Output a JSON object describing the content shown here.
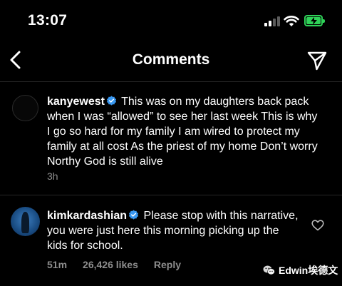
{
  "status_bar": {
    "time": "13:07",
    "battery_color": "#2fd158"
  },
  "header": {
    "title": "Comments",
    "back_icon": "chevron-left-icon",
    "share_icon": "paper-plane-icon"
  },
  "comments": [
    {
      "username": "kanyewest",
      "verified": true,
      "text": "This was on my daughters back pack when I was “allowed” to see her last week This is why I go so hard for my family  I am wired to protect my family at all cost  As the priest of my home  Don’t worry Northy  God is still alive",
      "time": "3h"
    },
    {
      "username": "kimkardashian",
      "verified": true,
      "text": "Please stop with this narrative, you were just here this morning picking up the kids for school.",
      "time": "51m",
      "likes": "26,426 likes",
      "reply_label": "Reply"
    }
  ],
  "watermark": {
    "text": "Edwin埃德文"
  },
  "colors": {
    "background": "#000000",
    "secondary_text": "#8e8e8e",
    "verified_badge": "#3897f0",
    "divider": "#262626"
  }
}
